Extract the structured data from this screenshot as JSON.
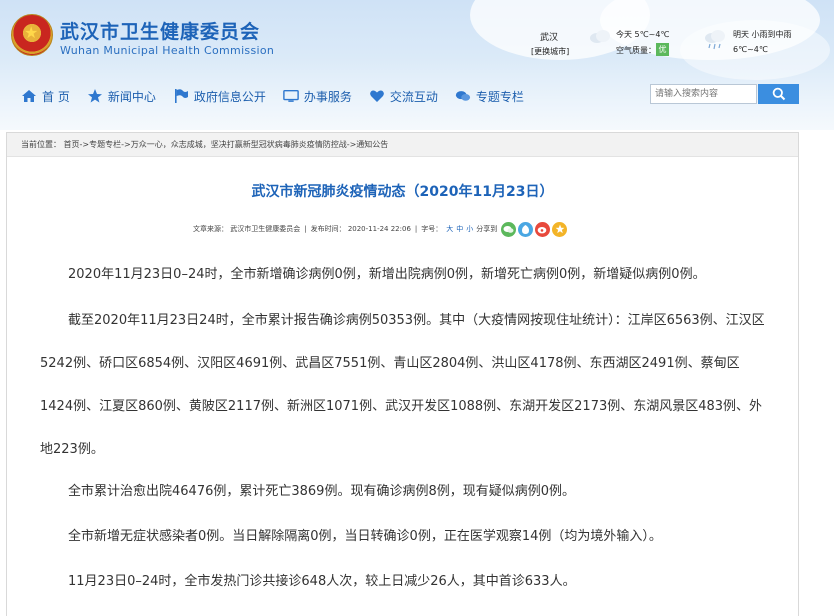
{
  "header": {
    "title_cn": "武汉市卫生健康委员会",
    "title_en": "Wuhan Municipal Health Commission",
    "weather": {
      "city": "武汉",
      "change_city": "[更换城市]",
      "today": "今天  5℃~4℃",
      "air_quality_label": "空气质量：",
      "air_quality_badge": "优",
      "tomorrow": "明天  小雨到中雨",
      "tomorrow_temp": "6℃~4℃"
    }
  },
  "nav": {
    "items": [
      {
        "label": "首 页",
        "icon": "home-icon"
      },
      {
        "label": "新闻中心",
        "icon": "star-icon"
      },
      {
        "label": "政府信息公开",
        "icon": "flag-icon"
      },
      {
        "label": "办事服务",
        "icon": "monitor-icon"
      },
      {
        "label": "交流互动",
        "icon": "heart-icon"
      },
      {
        "label": "专题专栏",
        "icon": "chat-icon"
      }
    ]
  },
  "search": {
    "placeholder": "请输入搜索内容"
  },
  "breadcrumb": "当前位置：  首页->专题专栏->万众一心，众志成城，坚决打赢新型冠状病毒肺炎疫情防控战->通知公告",
  "article": {
    "title": "武汉市新冠肺炎疫情动态（2020年11月23日）",
    "meta": {
      "source": "文章来源：  武汉市卫生健康委员会",
      "published": "发布时间：  2020-11-24 22:06",
      "font_label": "字号：",
      "font_large": "大",
      "font_medium": "中",
      "font_small": "小",
      "share_label": "分享到"
    },
    "paragraphs": [
      "2020年11月23日0–24时，全市新增确诊病例0例，新增出院病例0例，新增死亡病例0例，新增疑似病例0例。",
      "截至2020年11月23日24时，全市累计报告确诊病例50353例。其中（大疫情网按现住址统计）：江岸区6563例、江汉区5242例、硚口区6854例、汉阳区4691例、武昌区7551例、青山区2804例、洪山区4178例、东西湖区2491例、蔡甸区1424例、江夏区860例、黄陂区2117例、新洲区1071例、武汉开发区1088例、东湖开发区2173例、东湖风景区483例、外地223例。",
      "全市累计治愈出院46476例，累计死亡3869例。现有确诊病例8例，现有疑似病例0例。",
      "全市新增无症状感染者0例。当日解除隔离0例，当日转确诊0例，正在医学观察14例（均为境外输入）。",
      "11月23日0–24时，全市发热门诊共接诊648人次，较上日减少26人，其中首诊633人。"
    ]
  },
  "colors": {
    "brand_blue": "#1d63b8",
    "search_button": "#3b8ee0",
    "air_quality_good": "#5cb85c"
  }
}
